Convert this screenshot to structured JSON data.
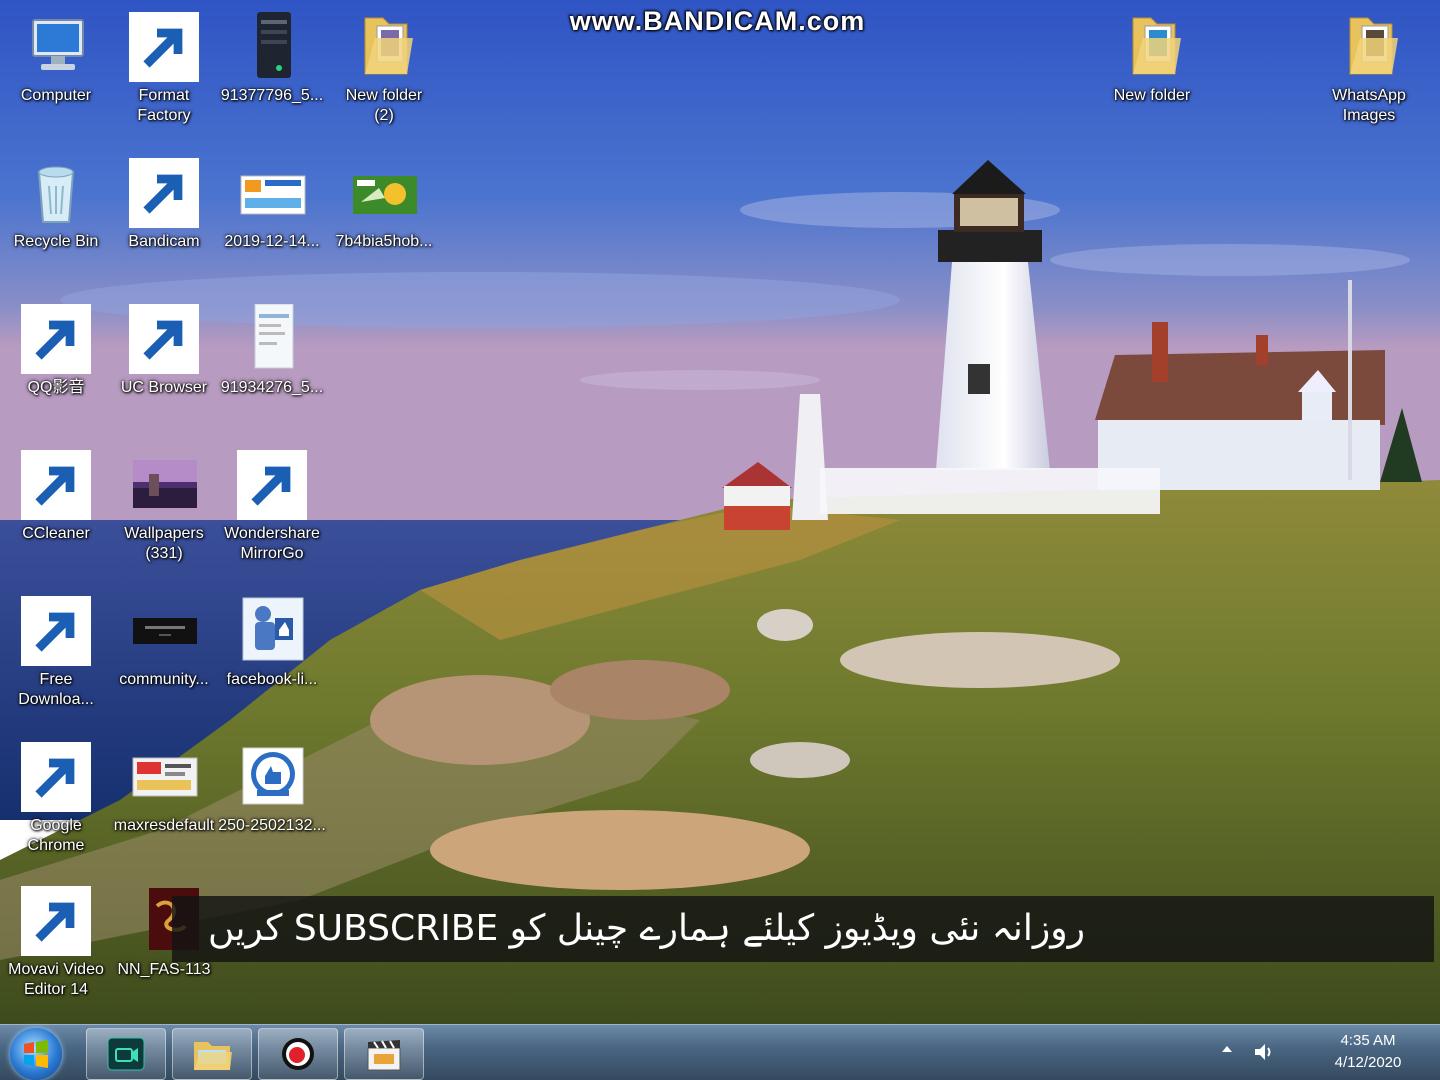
{
  "watermark": "www.BANDICAM.com",
  "desktop_icons": {
    "computer": "Computer",
    "format_factory": "Format\nFactory",
    "file_91377796": "91377796_5...",
    "new_folder_2": "New folder\n(2)",
    "new_folder": "New folder",
    "whatsapp_images": "WhatsApp\nImages",
    "recycle_bin": "Recycle Bin",
    "bandicam": "Bandicam",
    "image_2019": "2019-12-14...",
    "image_7b4": "7b4bia5hob...",
    "qq_player": "QQ影音",
    "uc_browser": "UC Browser",
    "file_91934276": "91934276_5...",
    "ccleaner": "CCleaner",
    "wallpapers": "Wallpapers\n(331)",
    "wondershare": "Wondershare\nMirrorGo",
    "free_download": "Free\nDownloa...",
    "community": "community...",
    "facebook": "facebook-li...",
    "google_chrome": "Google\nChrome",
    "maxresdefault": "maxresdefault",
    "file_250": "250-2502132...",
    "movavi": "Movavi Video\nEditor 14",
    "nn_fas": "NN_FAS-113"
  },
  "banner": {
    "text": "روزانہ نئی ویڈیوز کیلئے ہمارے چینل کو SUBSCRIBE کریں"
  },
  "taskbar": {
    "time": "4:35 AM",
    "date": "4/12/2020",
    "buttons": [
      "movavi-icon",
      "explorer-icon",
      "bandicam-icon",
      "video-clapper-icon"
    ]
  },
  "colors": {
    "sky": "#3f63b8",
    "sea": "#1f3f88",
    "grass": "#6c7a2c",
    "taskbar": "#4a6682"
  }
}
